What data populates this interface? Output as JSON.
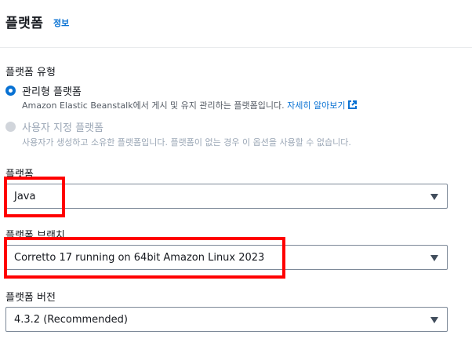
{
  "header": {
    "title": "플랫폼",
    "info_link": "정보"
  },
  "platform_type": {
    "label": "플랫폼 유형",
    "options": [
      {
        "label": "관리형 플랫폼",
        "description": "Amazon Elastic Beanstalk에서 게시 및 유지 관리하는 플랫폼입니다.",
        "learn_more": "자세히 알아보기",
        "selected": true,
        "disabled": false
      },
      {
        "label": "사용자 지정 플랫폼",
        "description": "사용자가 생성하고 소유한 플랫폼입니다. 플랫폼이 없는 경우 이 옵션을 사용할 수 없습니다.",
        "selected": false,
        "disabled": true
      }
    ]
  },
  "platform": {
    "label": "플랫폼",
    "value": "Java"
  },
  "platform_branch": {
    "label": "플랫폼 브랜치",
    "value": "Corretto 17 running on 64bit Amazon Linux 2023"
  },
  "platform_version": {
    "label": "플랫폼 버전",
    "value": "4.3.2 (Recommended)"
  },
  "colors": {
    "accent": "#0972d3",
    "highlight": "#ff0000",
    "text": "#16191f",
    "muted": "#545b64",
    "disabled": "#9ba7b6"
  }
}
